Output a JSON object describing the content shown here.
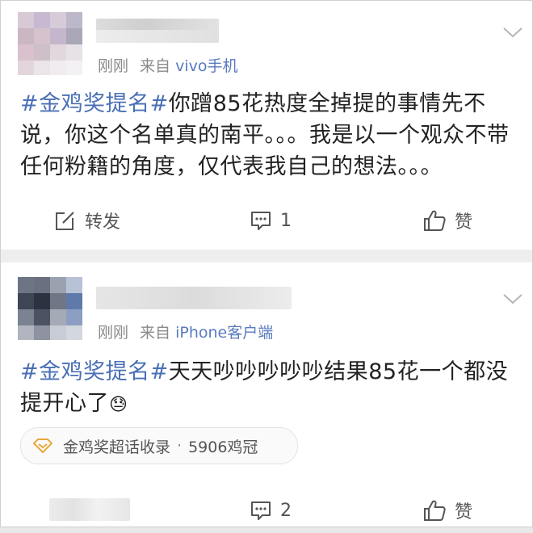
{
  "colors": {
    "link": "#4a6fb5",
    "source": "#5a7bbf",
    "meta": "#8a8a8a",
    "separator": "#eeeeee"
  },
  "post1": {
    "time": "刚刚",
    "source_prefix": "来自",
    "source": "vivo手机",
    "hashtag": "#金鸡奖提名#",
    "text": "你蹭85花热度全掉提的事情先不说，你这个名单真的南平。。。我是以一个观众不带任何粉籍的角度，仅代表我自己的想法。。。",
    "actions": {
      "repost_label": "转发",
      "comment_count": "1",
      "like_label": "赞"
    },
    "icons": [
      "chevron-down-icon",
      "repost-icon",
      "comment-icon",
      "like-icon"
    ]
  },
  "post2": {
    "time": "刚刚",
    "source_prefix": "来自",
    "source": "iPhone客户端",
    "hashtag": "#金鸡奖提名#",
    "text": "天天吵吵吵吵吵结果85花一个都没提开心了",
    "emoji": "😓",
    "supertopic": {
      "name": "金鸡奖超话收录",
      "separator": "·",
      "count": "5906鸡冠"
    },
    "actions": {
      "comment_count": "2",
      "like_label": "赞"
    },
    "icons": [
      "chevron-down-icon",
      "diamond-icon",
      "comment-icon",
      "like-icon"
    ]
  }
}
